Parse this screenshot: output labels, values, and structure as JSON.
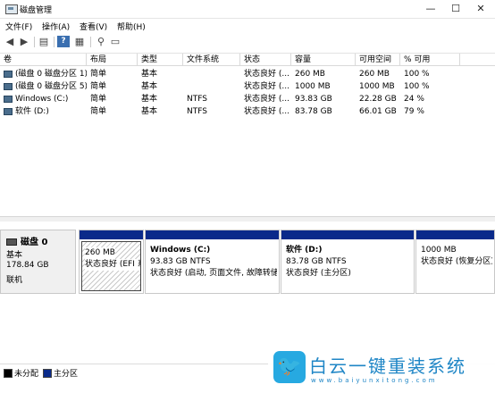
{
  "window": {
    "title": "磁盘管理",
    "controls": {
      "minimize": "—",
      "maximize": "☐",
      "close": "✕"
    }
  },
  "menu": [
    "文件(F)",
    "操作(A)",
    "查看(V)",
    "帮助(H)"
  ],
  "toolbar": {
    "icons": [
      "back-arrow-icon",
      "forward-arrow-icon",
      "properties-icon",
      "help-icon",
      "console-icon",
      "connect-icon",
      "view-icon"
    ]
  },
  "table": {
    "headers": [
      "卷",
      "布局",
      "类型",
      "文件系统",
      "状态",
      "容量",
      "可用空间",
      "% 可用"
    ],
    "rows": [
      [
        "(磁盘 0 磁盘分区 1)",
        "简单",
        "基本",
        "",
        "状态良好 (...",
        "260 MB",
        "260 MB",
        "100 %"
      ],
      [
        "(磁盘 0 磁盘分区 5)",
        "简单",
        "基本",
        "",
        "状态良好 (...",
        "1000 MB",
        "1000 MB",
        "100 %"
      ],
      [
        "Windows (C:)",
        "简单",
        "基本",
        "NTFS",
        "状态良好 (...",
        "93.83 GB",
        "22.28 GB",
        "24 %"
      ],
      [
        "软件 (D:)",
        "简单",
        "基本",
        "NTFS",
        "状态良好 (...",
        "83.78 GB",
        "66.01 GB",
        "79 %"
      ]
    ]
  },
  "disk": {
    "name": "磁盘 0",
    "type": "基本",
    "size": "178.84 GB",
    "status": "联机",
    "partitions": [
      {
        "name": "",
        "size": "260 MB",
        "status": "状态良好 (EFI 系"
      },
      {
        "name": "Windows (C:)",
        "size": "93.83 GB NTFS",
        "status": "状态良好 (启动, 页面文件, 故障转储"
      },
      {
        "name": "软件 (D:)",
        "size": "83.78 GB NTFS",
        "status": "状态良好 (主分区)"
      },
      {
        "name": "",
        "size": "1000 MB",
        "status": "状态良好 (恢复分区)"
      }
    ]
  },
  "legend": [
    {
      "label": "未分配",
      "color": "#000000"
    },
    {
      "label": "主分区",
      "color": "#0a2a8a"
    }
  ],
  "watermark": {
    "brand": "白云一键重装系统",
    "url": "www.baiyunxitong.com"
  }
}
